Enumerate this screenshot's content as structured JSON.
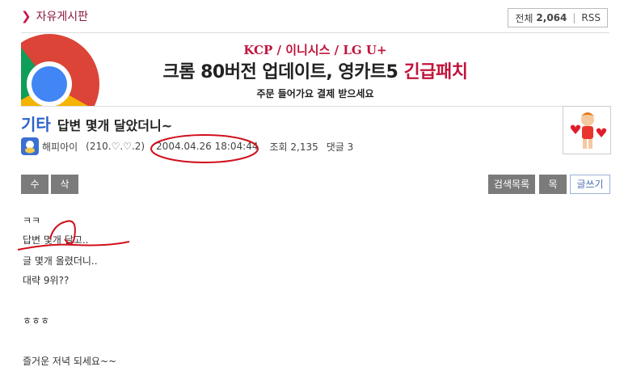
{
  "board": {
    "title": "자유게시판",
    "total_label": "전체",
    "total_count": "2,064",
    "rss": "RSS"
  },
  "banner": {
    "sub": "KCP / 이니시스 / LG U+",
    "headline_main": "크롬 80버전 업데이트, 영카트5",
    "headline_red": "긴급패치",
    "note": "주문 들어가요  결제 받으세요"
  },
  "post": {
    "category": "기타",
    "title": "답변 몇개 달았더니~",
    "author": "해피아이",
    "ip": "(210.♡.♡.2)",
    "datetime": "2004.04.26 18:04:44",
    "views_label": "조회",
    "views": "2,135",
    "comments_label": "댓글",
    "comments": "3"
  },
  "buttons": {
    "edit": "수정",
    "delete": "삭제",
    "search_list": "검색목록",
    "list": "목록",
    "write": "글쓰기"
  },
  "content": {
    "lines": [
      "ㅋㅋ",
      "답변 몇개 달고..",
      "글 몇개 올렸더니..",
      "대략 9위??",
      "",
      "ㅎㅎㅎ",
      "",
      "즐거운 저녁 되세요~~"
    ]
  },
  "colors": {
    "accent": "#c0143c",
    "category": "#2a62c9",
    "button": "#7b7b7b",
    "annotation": "#d0101c"
  },
  "icons": [
    "chevron-right-icon",
    "chrome-logo-icon",
    "avatar-icon",
    "thumbnail-character-icon"
  ]
}
